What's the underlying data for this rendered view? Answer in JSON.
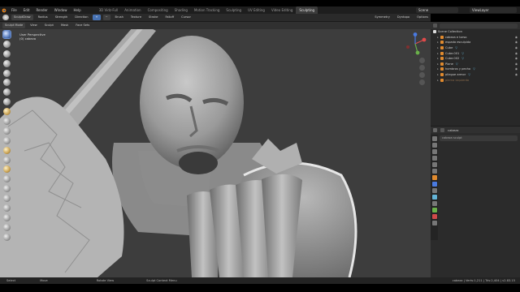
{
  "menu": [
    "File",
    "Edit",
    "Render",
    "Window",
    "Help"
  ],
  "workspace_tabs": [
    {
      "label": "3D Vidz-Full",
      "active": false
    },
    {
      "label": "Animation",
      "active": false
    },
    {
      "label": "Compositing",
      "active": false
    },
    {
      "label": "Shading",
      "active": false
    },
    {
      "label": "Motion Tracking",
      "active": false
    },
    {
      "label": "Sculpting",
      "active": false
    },
    {
      "label": "UV Editing",
      "active": false
    },
    {
      "label": "Video Editing",
      "active": false
    },
    {
      "label": "Sculpting",
      "active": true
    }
  ],
  "scene": {
    "label": "Scene",
    "view_layer": "ViewLayer"
  },
  "toolbar": {
    "brush": "SculptDraw",
    "radius": "Radius",
    "strength": "Strength",
    "direction": "Direction",
    "plus": "+",
    "minus": "−",
    "brush_menu": "Brush",
    "texture": "Texture",
    "stroke": "Stroke",
    "falloff": "Falloff",
    "cursor": "Cursor",
    "symmetry": "Symmetry",
    "dyntopo": "Dyntopo",
    "options": "Options"
  },
  "header2": {
    "mode": "Sculpt Mode",
    "view": "View",
    "sculpt": "Sculpt",
    "mask": "Mask",
    "facesets": "Face Sets"
  },
  "viewport": {
    "overlay_line1": "User Perspective",
    "overlay_line2": "(0) cabeza"
  },
  "outliner": {
    "header": "Scene Collection",
    "rows": [
      {
        "label": "Scene Collection",
        "indent": 0,
        "type": "coll"
      },
      {
        "label": "cabeza e torso",
        "indent": 1,
        "type": "obj"
      },
      {
        "label": "espada esculpida",
        "indent": 1,
        "type": "obj"
      },
      {
        "label": "Cube",
        "indent": 1,
        "type": "obj"
      },
      {
        "label": "Cube.001",
        "indent": 1,
        "type": "obj"
      },
      {
        "label": "Cube.002",
        "indent": 1,
        "type": "obj"
      },
      {
        "label": "Plane",
        "indent": 1,
        "type": "obj"
      },
      {
        "label": "hombros y pecho",
        "indent": 1,
        "type": "obj"
      },
      {
        "label": "pliegue armor",
        "indent": 1,
        "type": "obj"
      },
      {
        "label": "pierna izquierda",
        "indent": 1,
        "type": "obj"
      }
    ]
  },
  "properties": {
    "header": "cabeza",
    "search_placeholder": "cabeza sculpt"
  },
  "statusbar": {
    "select": "Select",
    "move": "Move",
    "rotate": "Rotate View",
    "context": "Sculpt Context Menu",
    "info": "cabeza | Verts:1,211 | Tris:2,404 | v2.83.15"
  },
  "colors": {
    "accent": "#4772b3",
    "viewport_bg": "#3d3d3d",
    "object_icon": "#e08a2e",
    "vertex_icon": "#63b3d6"
  }
}
